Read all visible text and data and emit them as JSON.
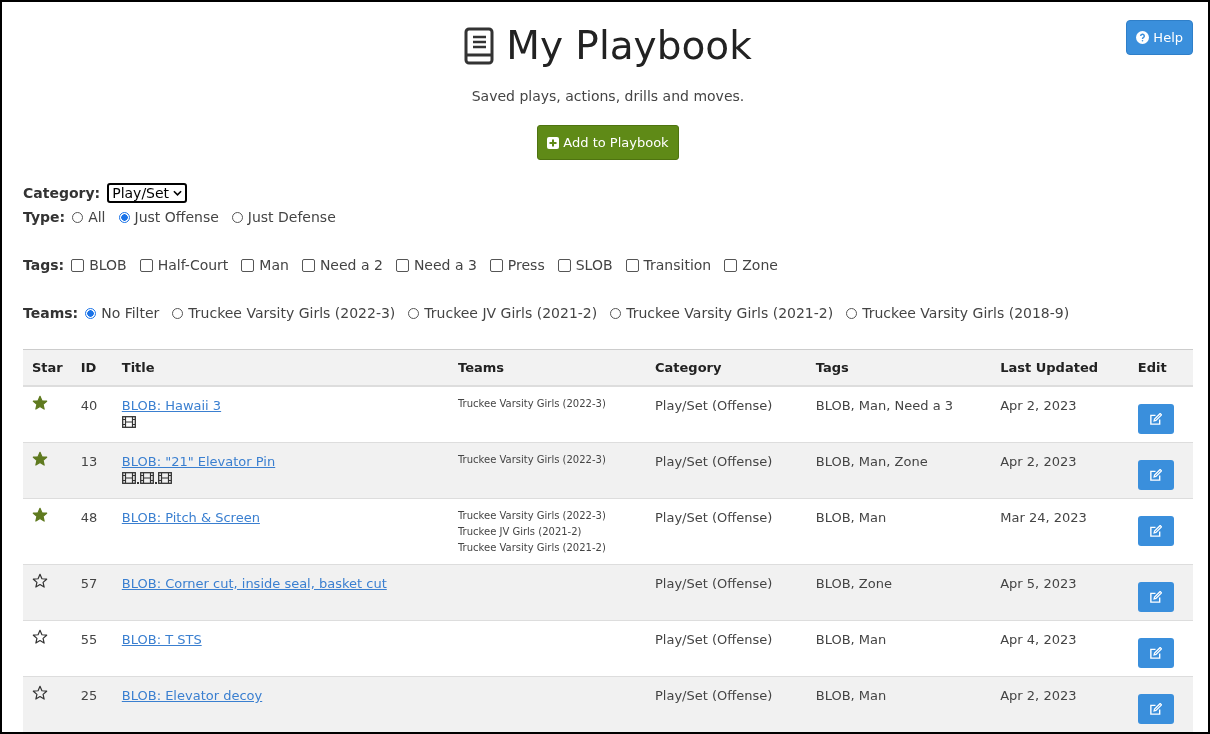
{
  "header": {
    "title": "My Playbook",
    "subtitle": "Saved plays, actions, drills and moves.",
    "help_button": "Help",
    "add_button": "Add to Playbook"
  },
  "filters": {
    "category": {
      "label": "Category:",
      "value": "Play/Set"
    },
    "type": {
      "label": "Type:",
      "options": [
        {
          "label": "All",
          "selected": false
        },
        {
          "label": "Just Offense",
          "selected": true
        },
        {
          "label": "Just Defense",
          "selected": false
        }
      ]
    },
    "tags": {
      "label": "Tags:",
      "options": [
        {
          "label": "BLOB",
          "checked": false
        },
        {
          "label": "Half-Court",
          "checked": false
        },
        {
          "label": "Man",
          "checked": false
        },
        {
          "label": "Need a 2",
          "checked": false
        },
        {
          "label": "Need a 3",
          "checked": false
        },
        {
          "label": "Press",
          "checked": false
        },
        {
          "label": "SLOB",
          "checked": false
        },
        {
          "label": "Transition",
          "checked": false
        },
        {
          "label": "Zone",
          "checked": false
        }
      ]
    },
    "teams": {
      "label": "Teams:",
      "options": [
        {
          "label": "No Filter",
          "selected": true
        },
        {
          "label": "Truckee Varsity Girls (2022-3)",
          "selected": false
        },
        {
          "label": "Truckee JV Girls (2021-2)",
          "selected": false
        },
        {
          "label": "Truckee Varsity Girls (2021-2)",
          "selected": false
        },
        {
          "label": "Truckee Varsity Girls (2018-9)",
          "selected": false
        }
      ]
    }
  },
  "table": {
    "columns": [
      "Star",
      "ID",
      "Title",
      "Teams",
      "Category",
      "Tags",
      "Last Updated",
      "Edit"
    ],
    "rows": [
      {
        "starred": true,
        "id": "40",
        "title": "BLOB: Hawaii 3",
        "attachments": [
          {
            "kind": "video"
          }
        ],
        "teams": [
          "Truckee Varsity Girls (2022-3)"
        ],
        "category": "Play/Set (Offense)",
        "tags": "BLOB, Man, Need a 3",
        "updated": "Apr 2, 2023"
      },
      {
        "starred": true,
        "id": "13",
        "title": "BLOB: \"21\" Elevator Pin",
        "attachments": [
          {
            "kind": "video"
          },
          {
            "kind": "video"
          },
          {
            "kind": "video"
          }
        ],
        "teams": [
          "Truckee Varsity Girls (2022-3)"
        ],
        "category": "Play/Set (Offense)",
        "tags": "BLOB, Man, Zone",
        "updated": "Apr 2, 2023"
      },
      {
        "starred": true,
        "id": "48",
        "title": "BLOB: Pitch & Screen",
        "teams": [
          "Truckee Varsity Girls (2022-3)",
          "Truckee JV Girls (2021-2)",
          "Truckee Varsity Girls (2021-2)"
        ],
        "category": "Play/Set (Offense)",
        "tags": "BLOB, Man",
        "updated": "Mar 24, 2023"
      },
      {
        "starred": false,
        "id": "57",
        "title": "BLOB: Corner cut, inside seal, basket cut",
        "teams": [],
        "category": "Play/Set (Offense)",
        "tags": "BLOB, Zone",
        "updated": "Apr 5, 2023"
      },
      {
        "starred": false,
        "id": "55",
        "title": "BLOB: T STS",
        "teams": [],
        "category": "Play/Set (Offense)",
        "tags": "BLOB, Man",
        "updated": "Apr 4, 2023"
      },
      {
        "starred": false,
        "id": "25",
        "title": "BLOB: Elevator decoy",
        "teams": [],
        "category": "Play/Set (Offense)",
        "tags": "BLOB, Man",
        "updated": "Apr 2, 2023"
      }
    ]
  }
}
